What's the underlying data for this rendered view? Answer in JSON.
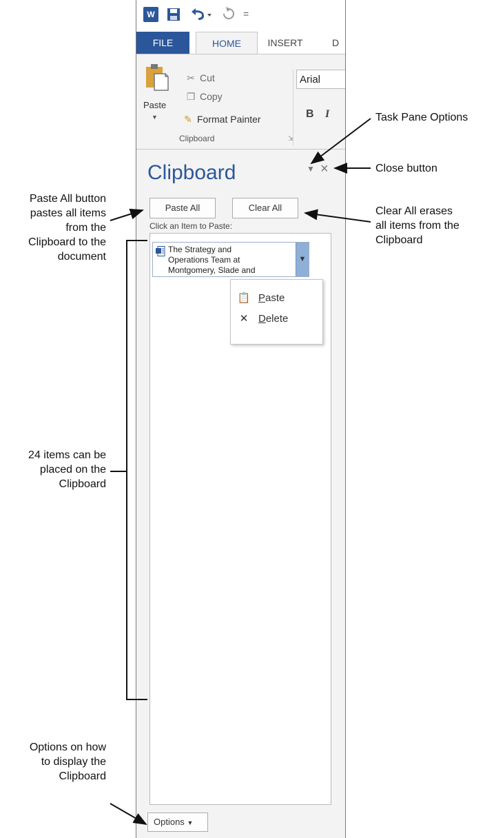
{
  "quick_access": {
    "app_icon": "W",
    "more": "="
  },
  "tabs": {
    "file": "FILE",
    "home": "HOME",
    "insert": "INSERT",
    "design": "D"
  },
  "ribbon": {
    "paste": "Paste",
    "cut": "Cut",
    "copy": "Copy",
    "format_painter": "Format Painter",
    "group_label": "Clipboard",
    "font_name": "Arial",
    "bold": "B",
    "italic": "I"
  },
  "pane": {
    "title": "Clipboard",
    "paste_all": "Paste All",
    "clear_all": "Clear All",
    "click_hint": "Click an Item to Paste:",
    "item_text": "The Strategy and\nOperations Team at\nMontgomery, Slade and",
    "context_menu": {
      "paste_rest": "aste",
      "paste_key": "P",
      "delete_key": "D",
      "delete_rest": "elete"
    },
    "options": "Options"
  },
  "callouts": {
    "task_pane_options": "Task Pane Options",
    "close_button": "Close button",
    "clear_all": "Clear All erases\nall items from the\nClipboard",
    "paste_all": "Paste All button\npastes all items\nfrom the\nClipboard to the\ndocument",
    "items_24": "24 items can be\nplaced on the\nClipboard",
    "options": "Options on how\nto display the\nClipboard"
  },
  "colors": {
    "word_blue": "#2b579a",
    "item_drop": "#8fb0d6"
  }
}
